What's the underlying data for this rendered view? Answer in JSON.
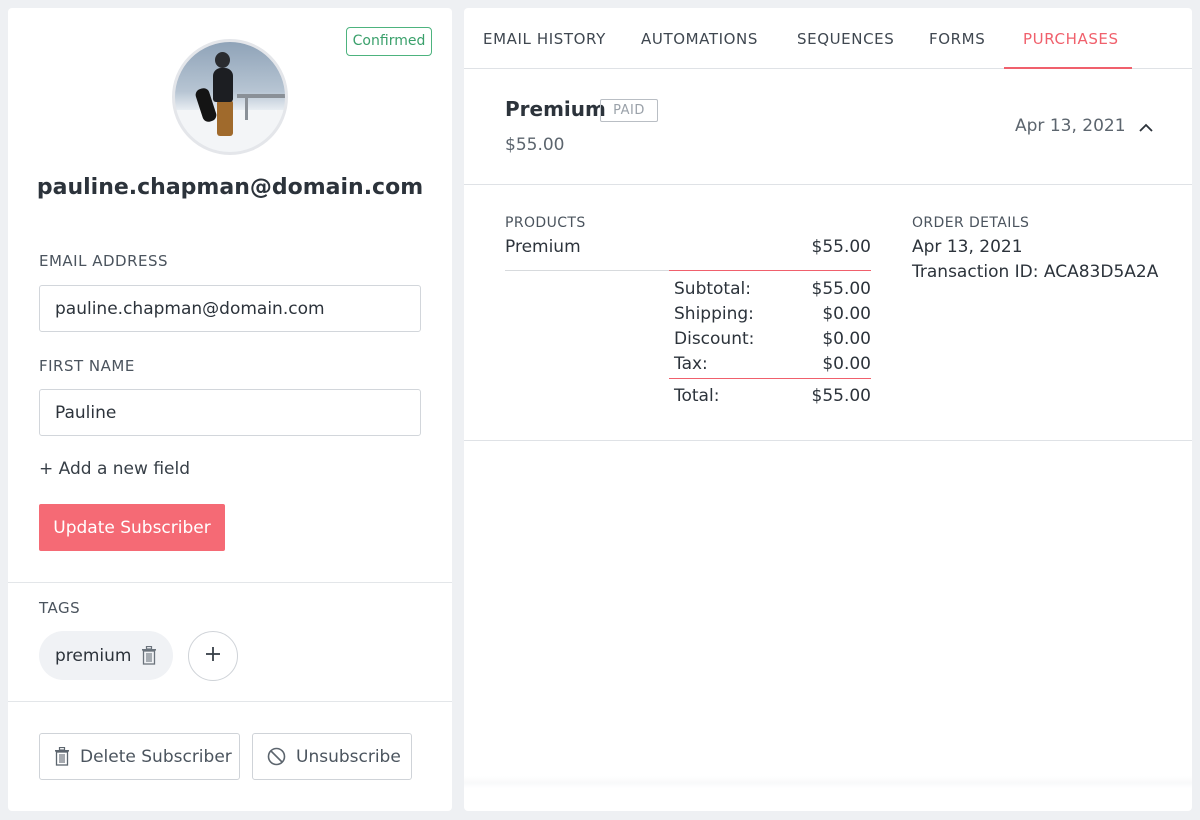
{
  "subscriber": {
    "status_badge": "Confirmed",
    "display_email": "pauline.chapman@domain.com"
  },
  "form": {
    "email_label": "EMAIL ADDRESS",
    "email_value": "pauline.chapman@domain.com",
    "first_name_label": "FIRST NAME",
    "first_name_value": "Pauline",
    "add_field_label": "+ Add a new field",
    "update_button": "Update Subscriber"
  },
  "tags": {
    "label": "TAGS",
    "items": [
      "premium"
    ],
    "add_icon": "plus-icon"
  },
  "actions": {
    "delete_label": "Delete Subscriber",
    "unsubscribe_label": "Unsubscribe"
  },
  "tabs": [
    {
      "label": "EMAIL HISTORY",
      "active": false
    },
    {
      "label": "AUTOMATIONS",
      "active": false
    },
    {
      "label": "SEQUENCES",
      "active": false
    },
    {
      "label": "FORMS",
      "active": false
    },
    {
      "label": "PURCHASES",
      "active": true
    }
  ],
  "purchase": {
    "title": "Premium",
    "badge": "PAID",
    "price": "$55.00",
    "date": "Apr 13, 2021",
    "products_label": "PRODUCTS",
    "products": [
      {
        "name": "Premium",
        "amount": "$55.00"
      }
    ],
    "summary": [
      {
        "label": "Subtotal:",
        "amount": "$55.00"
      },
      {
        "label": "Shipping:",
        "amount": "$0.00"
      },
      {
        "label": "Discount:",
        "amount": "$0.00"
      },
      {
        "label": "Tax:",
        "amount": "$0.00"
      }
    ],
    "total": {
      "label": "Total:",
      "amount": "$55.00"
    },
    "order_details_label": "ORDER DETAILS",
    "order_date": "Apr 13, 2021",
    "transaction": "Transaction ID: ACA83D5A2A"
  },
  "colors": {
    "accent": "#f56a75",
    "confirmed": "#3aa06b",
    "background": "#eef0f3"
  }
}
